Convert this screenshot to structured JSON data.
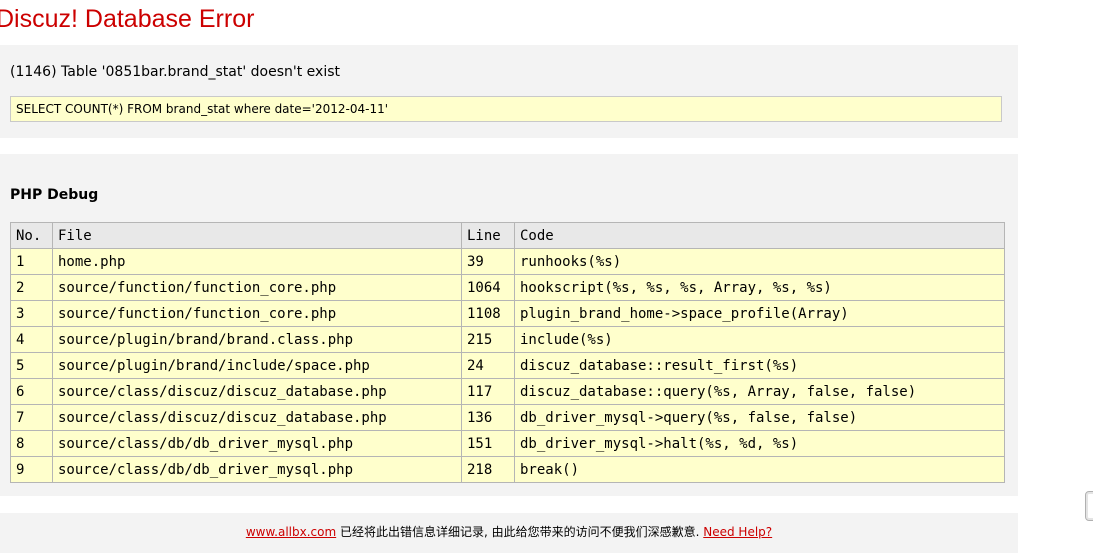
{
  "page": {
    "title": "Discuz! Database Error"
  },
  "error": {
    "message": "(1146) Table '0851bar.brand_stat' doesn't exist",
    "sql": "SELECT COUNT(*) FROM brand_stat where date='2012-04-11'"
  },
  "debug": {
    "title": "PHP Debug",
    "columns": [
      "No.",
      "File",
      "Line",
      "Code"
    ],
    "rows": [
      [
        "1",
        "home.php",
        "39",
        "runhooks(%s)"
      ],
      [
        "2",
        "source/function/function_core.php",
        "1064",
        "hookscript(%s, %s, %s, Array, %s, %s)"
      ],
      [
        "3",
        "source/function/function_core.php",
        "1108",
        "plugin_brand_home->space_profile(Array)"
      ],
      [
        "4",
        "source/plugin/brand/brand.class.php",
        "215",
        "include(%s)"
      ],
      [
        "5",
        "source/plugin/brand/include/space.php",
        "24",
        "discuz_database::result_first(%s)"
      ],
      [
        "6",
        "source/class/discuz/discuz_database.php",
        "117",
        "discuz_database::query(%s, Array, false, false)"
      ],
      [
        "7",
        "source/class/discuz/discuz_database.php",
        "136",
        "db_driver_mysql->query(%s, false, false)"
      ],
      [
        "8",
        "source/class/db/db_driver_mysql.php",
        "151",
        "db_driver_mysql->halt(%s, %d, %s)"
      ],
      [
        "9",
        "source/class/db/db_driver_mysql.php",
        "218",
        "break()"
      ]
    ]
  },
  "footer": {
    "site_link": "www.allbx.com",
    "message": " 已经将此出错信息详细记录, 由此给您带来的访问不便我们深感歉意. ",
    "help_link": "Need Help?"
  },
  "colors": {
    "title": "#cc0000",
    "panel_bg": "#f3f3f3",
    "highlight_bg": "#ffffcc",
    "link": "#cc0000"
  }
}
